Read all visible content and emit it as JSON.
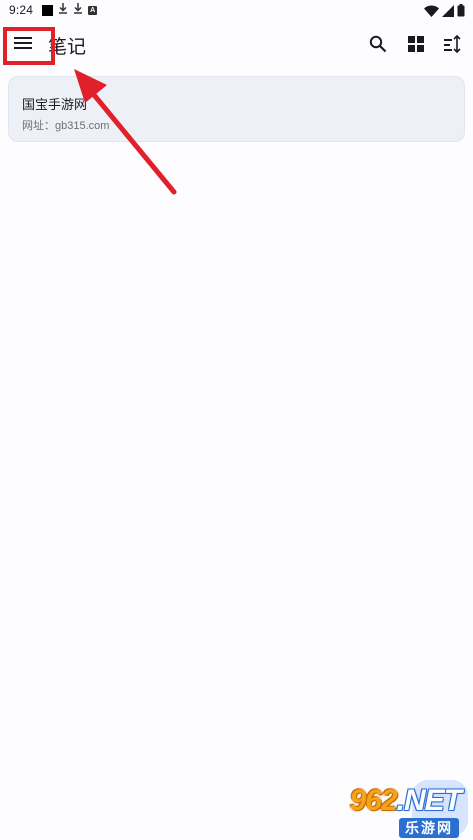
{
  "status_bar": {
    "time": "9:24",
    "left_icons": [
      "black-square-icon",
      "download-icon",
      "download-icon",
      "a-icon"
    ],
    "right_icons": [
      "wifi-icon",
      "signal-icon",
      "battery-icon"
    ]
  },
  "app_bar": {
    "title": "笔记",
    "actions": [
      "search-icon",
      "grid-view-icon",
      "sort-icon"
    ]
  },
  "notes": [
    {
      "title": "国宝手游网",
      "body": "网址：gb315.com"
    }
  ],
  "annotation": {
    "color": "#e0202a"
  },
  "watermark": {
    "logo_text": "962",
    "logo_suffix": ".NET",
    "sub_text": "乐游网"
  },
  "colors": {
    "background": "#fdfcff",
    "card": "#edf0f6",
    "fab": "#d6e4ff"
  }
}
